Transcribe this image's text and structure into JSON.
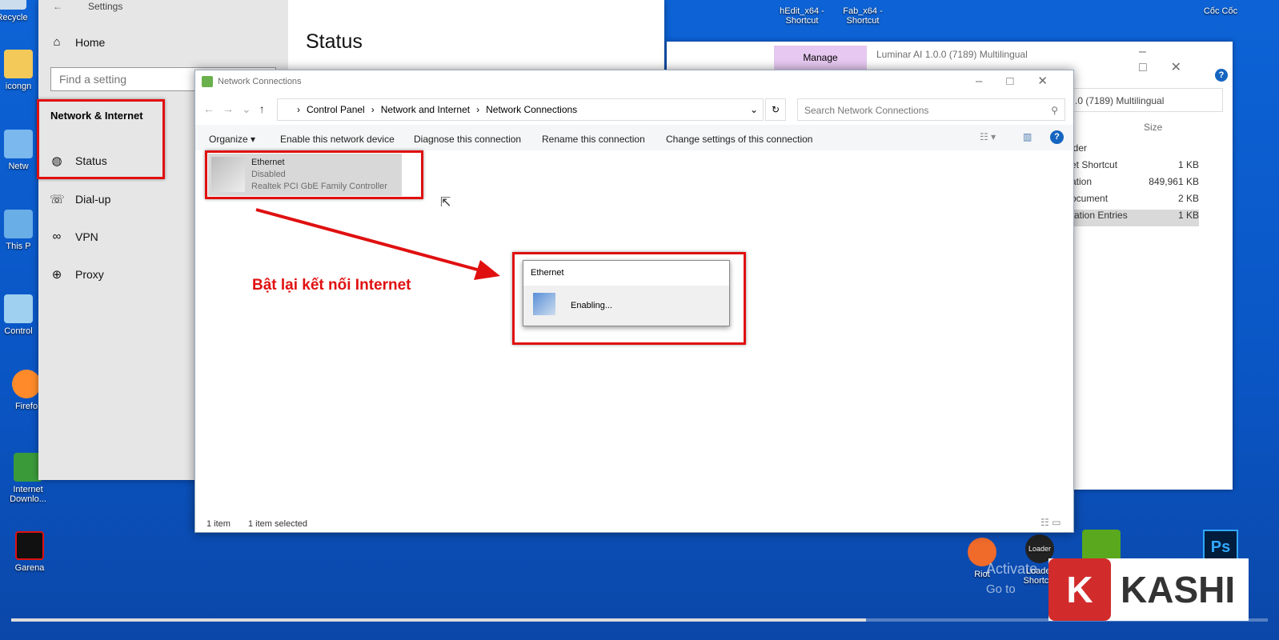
{
  "desktop": {
    "left_icons": [
      "Recycle",
      "icongn",
      "Netw",
      "This P",
      "Control",
      "Firefo",
      "Internet Downlo...",
      "Garena"
    ],
    "top_icons": [
      "hEdit_x64 - Shortcut",
      "Fab_x64 - Shortcut",
      "Cốc Cốc"
    ],
    "bottom_icons": [
      "Riot",
      "Loader Shortcut"
    ],
    "ps_label": "Ps",
    "loader_badge": "Loader",
    "watermark_line1": "Activate",
    "watermark_line2": "Go to"
  },
  "settings": {
    "title": "Settings",
    "home": "Home",
    "search_placeholder": "Find a setting",
    "section": "Network & Internet",
    "page_title": "Status",
    "nav": [
      {
        "label": "Status",
        "icon": "status-icon"
      },
      {
        "label": "Dial-up",
        "icon": "dialup-icon"
      },
      {
        "label": "VPN",
        "icon": "vpn-icon"
      },
      {
        "label": "Proxy",
        "icon": "globe-icon"
      }
    ]
  },
  "explorer_bg": {
    "manage_tab": "Manage",
    "title": "Luminar AI 1.0.0 (7189) Multilingual",
    "address": ".0 (7189) Multilingual",
    "size_header": "Size",
    "rows": [
      {
        "name": "lder",
        "size": ""
      },
      {
        "name": "et Shortcut",
        "size": "1 KB"
      },
      {
        "name": "ation",
        "size": "849,961 KB"
      },
      {
        "name": "ocument",
        "size": "2 KB"
      },
      {
        "name": "ration Entries",
        "size": "1 KB"
      }
    ]
  },
  "netconn": {
    "title": "Network Connections",
    "breadcrumb": [
      "Control Panel",
      "Network and Internet",
      "Network Connections"
    ],
    "search_placeholder": "Search Network Connections",
    "toolbar": [
      "Organize",
      "Enable this network device",
      "Diagnose this connection",
      "Rename this connection",
      "Change settings of this connection"
    ],
    "item": {
      "name": "Ethernet",
      "status": "Disabled",
      "device": "Realtek PCI GbE Family Controller"
    },
    "status_bar": {
      "count": "1 item",
      "selected": "1 item selected"
    }
  },
  "dialog": {
    "title": "Ethernet",
    "message": "Enabling..."
  },
  "annotation": "Bật lại kết nối Internet",
  "logo": {
    "letter": "K",
    "text": "KASHI"
  },
  "video_progress": 0.68,
  "colors": {
    "accent_red": "#e01010",
    "desktop_blue": "#0d63d6",
    "manage_tab": "#e6c8f0"
  }
}
